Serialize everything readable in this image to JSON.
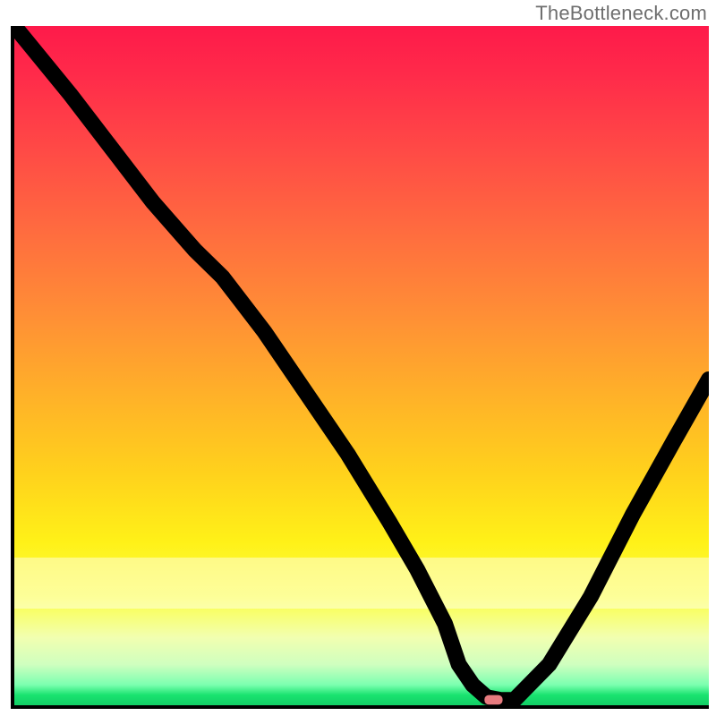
{
  "watermark": "TheBottleneck.com",
  "chart_data": {
    "type": "line",
    "title": "",
    "xlabel": "",
    "ylabel": "",
    "xlim": [
      0,
      100
    ],
    "ylim": [
      0,
      100
    ],
    "grid": false,
    "legend": false,
    "series": [
      {
        "name": "curve",
        "x": [
          0,
          8,
          14,
          20,
          26,
          30,
          36,
          42,
          48,
          54,
          58,
          62,
          64,
          66,
          68,
          70,
          72,
          77,
          83,
          89,
          95,
          100
        ],
        "y": [
          100,
          90,
          82,
          74,
          67,
          63,
          55,
          46,
          37,
          27,
          20,
          12,
          6,
          3,
          1.2,
          0.8,
          0.8,
          6,
          16,
          28,
          39,
          48
        ]
      }
    ],
    "marker": {
      "x": 69,
      "y": 0.8,
      "color": "#e77b7f",
      "shape": "rounded-rect"
    },
    "gradient_stops": [
      {
        "pct": 0,
        "color": "#fe1a4a"
      },
      {
        "pct": 18,
        "color": "#ff4946"
      },
      {
        "pct": 42,
        "color": "#ff8d36"
      },
      {
        "pct": 66,
        "color": "#ffd21c"
      },
      {
        "pct": 84,
        "color": "#fcff44"
      },
      {
        "pct": 94,
        "color": "#cfffbf"
      },
      {
        "pct": 100,
        "color": "#12cf66"
      }
    ]
  }
}
